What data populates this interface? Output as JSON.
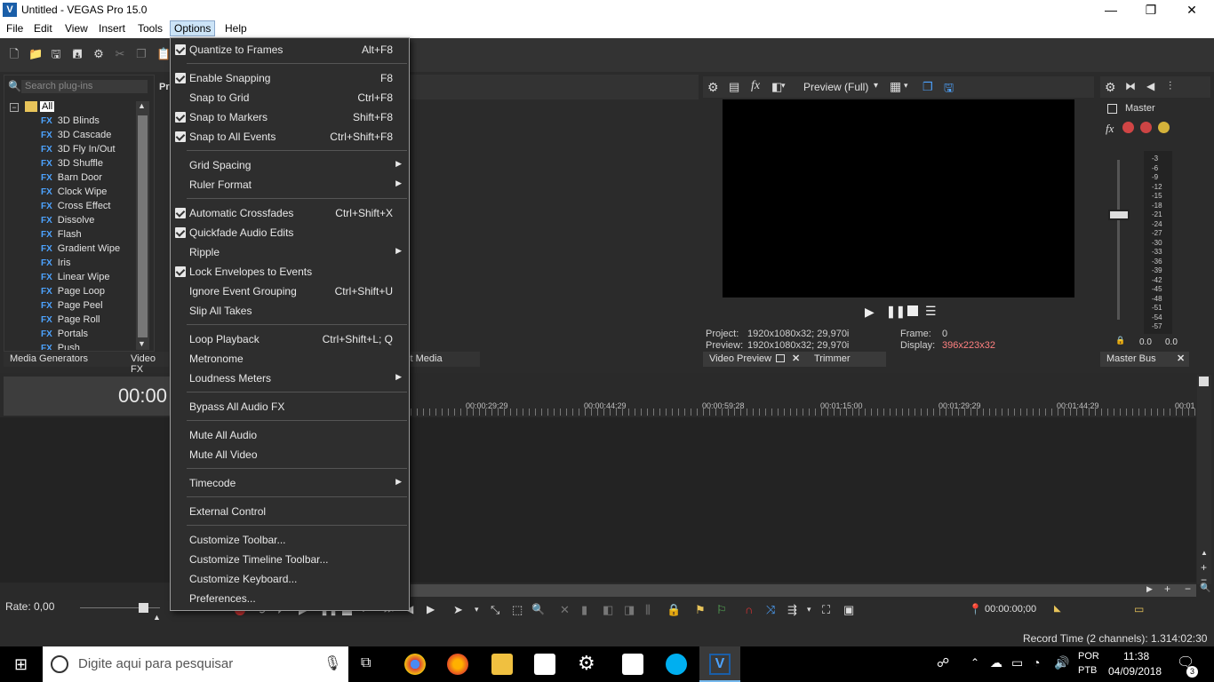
{
  "window": {
    "title": "Untitled - VEGAS Pro 15.0",
    "app_icon": "V",
    "minimize": "—",
    "restore": "❐",
    "close": "✕"
  },
  "menubar": [
    "File",
    "Edit",
    "View",
    "Insert",
    "Tools",
    "Options",
    "Help"
  ],
  "explorer": {
    "search_placeholder": "Search plug-ins",
    "pane_label": "Pr",
    "root": "All",
    "items": [
      "3D Blinds",
      "3D Cascade",
      "3D Fly In/Out",
      "3D Shuffle",
      "Barn Door",
      "Clock Wipe",
      "Cross Effect",
      "Dissolve",
      "Flash",
      "Gradient Wipe",
      "Iris",
      "Linear Wipe",
      "Page Loop",
      "Page Peel",
      "Page Roll",
      "Portals",
      "Push"
    ],
    "fx_tag": "FX"
  },
  "bottom_tabs": {
    "media_generators": "Media Generators",
    "video_fx": "Video FX",
    "project_media": "ct Media"
  },
  "preview": {
    "quality": "Preview (Full)",
    "project_label": "Project:",
    "project_value": "1920x1080x32; 29,970i",
    "preview_label": "Preview:",
    "preview_value": "1920x1080x32; 29,970i",
    "frame_label": "Frame:",
    "frame_value": "0",
    "display_label": "Display:",
    "display_value": "396x223x32",
    "tab_video_preview": "Video Preview",
    "tab_trimmer": "Trimmer"
  },
  "master": {
    "title": "Master",
    "scale": [
      "-3",
      "-6",
      "-9",
      "-12",
      "-15",
      "-18",
      "-21",
      "-24",
      "-27",
      "-30",
      "-33",
      "-36",
      "-39",
      "-42",
      "-45",
      "-48",
      "-51",
      "-54",
      "-57"
    ],
    "left_value": "0.0",
    "right_value": "0.0",
    "tab": "Master Bus"
  },
  "timeline": {
    "timecode": "00:00",
    "ruler": [
      "00:00:29:29",
      "00:00:44:29",
      "00:00:59:28",
      "00:01:15:00",
      "00:01:29:29",
      "00:01:44:29",
      "00:01"
    ],
    "rate": "Rate: 0,00",
    "cursor_time": "00:00:00;00"
  },
  "status": {
    "record_time": "Record Time (2 channels): 1.314:02:30"
  },
  "taskbar": {
    "search_placeholder": "Digite aqui para pesquisar",
    "lang1": "POR",
    "lang2": "PTB",
    "time": "11:38",
    "date": "04/09/2018",
    "notifications": "3"
  },
  "options_menu": [
    {
      "label": "Quantize to Frames",
      "shortcut": "Alt+F8",
      "checked": true
    },
    {
      "sep": true
    },
    {
      "label": "Enable Snapping",
      "shortcut": "F8",
      "checked": true
    },
    {
      "label": "Snap to Grid",
      "shortcut": "Ctrl+F8",
      "checked": false
    },
    {
      "label": "Snap to Markers",
      "shortcut": "Shift+F8",
      "checked": true
    },
    {
      "label": "Snap to All Events",
      "shortcut": "Ctrl+Shift+F8",
      "checked": true
    },
    {
      "sep": true
    },
    {
      "label": "Grid Spacing",
      "submenu": true
    },
    {
      "label": "Ruler Format",
      "submenu": true
    },
    {
      "sep": true
    },
    {
      "label": "Automatic Crossfades",
      "shortcut": "Ctrl+Shift+X",
      "checked": true
    },
    {
      "label": "Quickfade Audio Edits",
      "checked": true
    },
    {
      "label": "Ripple",
      "submenu": true
    },
    {
      "label": "Lock Envelopes to Events",
      "checked": true
    },
    {
      "label": "Ignore Event Grouping",
      "shortcut": "Ctrl+Shift+U"
    },
    {
      "label": "Slip All Takes"
    },
    {
      "sep": true
    },
    {
      "label": "Loop Playback",
      "shortcut": "Ctrl+Shift+L; Q"
    },
    {
      "label": "Metronome"
    },
    {
      "label": "Loudness Meters",
      "submenu": true
    },
    {
      "sep": true
    },
    {
      "label": "Bypass All Audio FX"
    },
    {
      "sep": true
    },
    {
      "label": "Mute All Audio"
    },
    {
      "label": "Mute All Video"
    },
    {
      "sep": true
    },
    {
      "label": "Timecode",
      "submenu": true
    },
    {
      "sep": true
    },
    {
      "label": "External Control"
    },
    {
      "sep": true
    },
    {
      "label": "Customize Toolbar..."
    },
    {
      "label": "Customize Timeline Toolbar..."
    },
    {
      "label": "Customize Keyboard..."
    },
    {
      "label": "Preferences..."
    }
  ],
  "colors": {
    "accent": "#1a5ea8",
    "display_value": "#ff8080",
    "fx_blue": "#4da3ff"
  }
}
